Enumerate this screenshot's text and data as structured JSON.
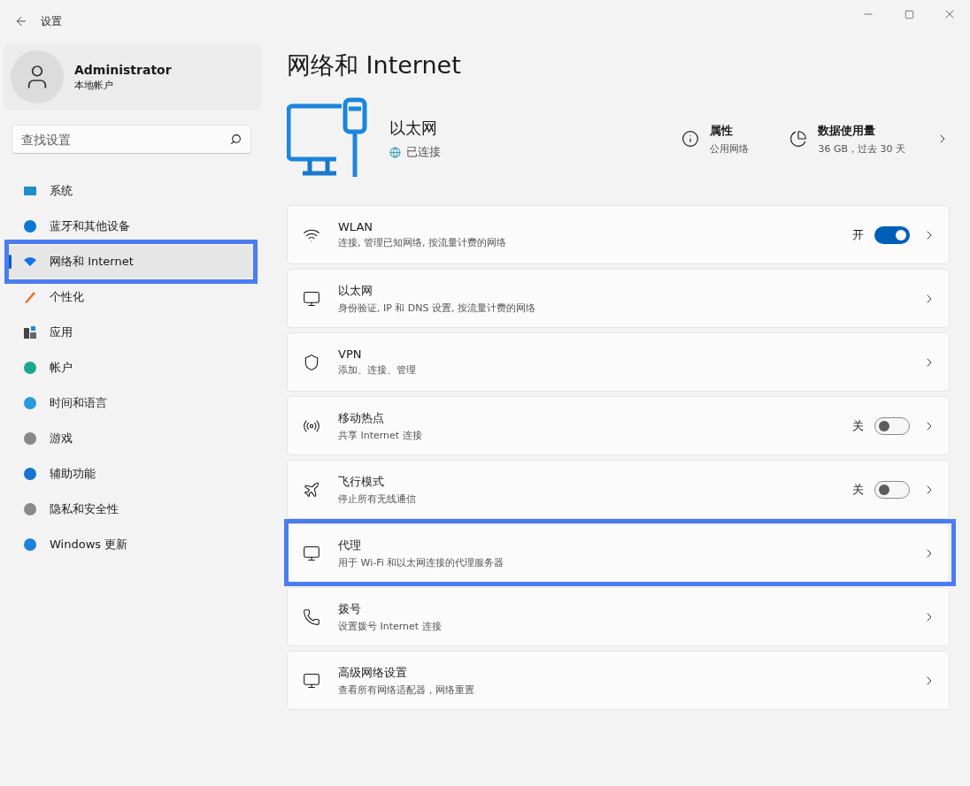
{
  "window": {
    "title": "设置"
  },
  "profile": {
    "name": "Administrator",
    "account": "本地帐户"
  },
  "search": {
    "placeholder": "查找设置"
  },
  "nav": [
    {
      "label": "系统",
      "selected": false,
      "highlighted": false
    },
    {
      "label": "蓝牙和其他设备",
      "selected": false,
      "highlighted": false
    },
    {
      "label": "网络和 Internet",
      "selected": true,
      "highlighted": true
    },
    {
      "label": "个性化",
      "selected": false,
      "highlighted": false
    },
    {
      "label": "应用",
      "selected": false,
      "highlighted": false
    },
    {
      "label": "帐户",
      "selected": false,
      "highlighted": false
    },
    {
      "label": "时间和语言",
      "selected": false,
      "highlighted": false
    },
    {
      "label": "游戏",
      "selected": false,
      "highlighted": false
    },
    {
      "label": "辅助功能",
      "selected": false,
      "highlighted": false
    },
    {
      "label": "隐私和安全性",
      "selected": false,
      "highlighted": false
    },
    {
      "label": "Windows 更新",
      "selected": false,
      "highlighted": false
    }
  ],
  "page_title": "网络和 Internet",
  "header": {
    "name": "以太网",
    "status": "已连接",
    "properties": {
      "title": "属性",
      "value": "公用网络"
    },
    "usage": {
      "title": "数据使用量",
      "value": "36 GB，过去 30 天"
    }
  },
  "rows": [
    {
      "kind": "toggle",
      "title": "WLAN",
      "subtitle": "连接, 管理已知网络, 按流量计费的网络",
      "toggle_label": "开",
      "on": true,
      "highlighted": false
    },
    {
      "kind": "link",
      "title": "以太网",
      "subtitle": "身份验证, IP 和 DNS 设置, 按流量计费的网络",
      "highlighted": false
    },
    {
      "kind": "link",
      "title": "VPN",
      "subtitle": "添加、连接、管理",
      "highlighted": false
    },
    {
      "kind": "toggle",
      "title": "移动热点",
      "subtitle": "共享 Internet 连接",
      "toggle_label": "关",
      "on": false,
      "highlighted": false
    },
    {
      "kind": "toggle",
      "title": "飞行模式",
      "subtitle": "停止所有无线通信",
      "toggle_label": "关",
      "on": false,
      "highlighted": false
    },
    {
      "kind": "link",
      "title": "代理",
      "subtitle": "用于 Wi-Fi 和以太网连接的代理服务器",
      "highlighted": true
    },
    {
      "kind": "link",
      "title": "拨号",
      "subtitle": "设置拨号 Internet 连接",
      "highlighted": false
    },
    {
      "kind": "link",
      "title": "高级网络设置",
      "subtitle": "查看所有网络适配器，网络重置",
      "highlighted": false
    }
  ]
}
